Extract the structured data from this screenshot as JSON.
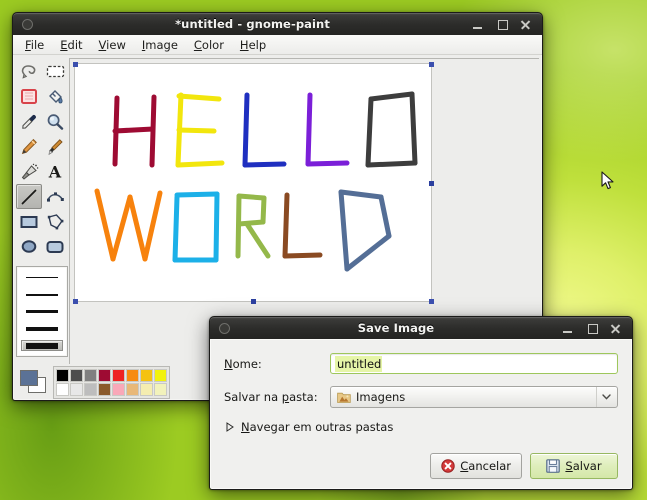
{
  "desktop": {
    "background_color": "#8fc524",
    "cursor": "arrow-pointer"
  },
  "paint_window": {
    "title": "*untitled - gnome-paint",
    "window_buttons": {
      "minimize": "minimize",
      "maximize": "maximize",
      "close": "close"
    },
    "menubar": [
      {
        "label": "File",
        "mnemonic": "F"
      },
      {
        "label": "Edit",
        "mnemonic": "E"
      },
      {
        "label": "View",
        "mnemonic": "V"
      },
      {
        "label": "Image",
        "mnemonic": "I"
      },
      {
        "label": "Color",
        "mnemonic": "C"
      },
      {
        "label": "Help",
        "mnemonic": "H"
      }
    ],
    "toolbox": [
      {
        "name": "free-form-select",
        "label": "Free-Form Select",
        "selected": false
      },
      {
        "name": "rectangle-select",
        "label": "Select",
        "selected": false
      },
      {
        "name": "eraser",
        "label": "Eraser",
        "selected": false
      },
      {
        "name": "fill-bucket",
        "label": "Fill With Color",
        "selected": false
      },
      {
        "name": "color-picker",
        "label": "Pick Color",
        "selected": false
      },
      {
        "name": "magnifier",
        "label": "Magnifier",
        "selected": false
      },
      {
        "name": "pencil",
        "label": "Pencil",
        "selected": false
      },
      {
        "name": "paintbrush",
        "label": "Brush",
        "selected": false
      },
      {
        "name": "airbrush",
        "label": "Airbrush",
        "selected": false
      },
      {
        "name": "text",
        "label": "Text",
        "selected": false
      },
      {
        "name": "line",
        "label": "Line",
        "selected": true
      },
      {
        "name": "curve",
        "label": "Curve",
        "selected": false
      },
      {
        "name": "rectangle",
        "label": "Rectangle",
        "selected": false
      },
      {
        "name": "polygon",
        "label": "Polygon",
        "selected": false
      },
      {
        "name": "ellipse",
        "label": "Ellipse",
        "selected": false
      },
      {
        "name": "rounded-rectangle",
        "label": "Rounded Rectangle",
        "selected": false
      }
    ],
    "line_widths": [
      {
        "thickness": 1,
        "selected": false
      },
      {
        "thickness": 2,
        "selected": false
      },
      {
        "thickness": 3,
        "selected": false
      },
      {
        "thickness": 4,
        "selected": false
      },
      {
        "thickness": 6,
        "selected": true
      }
    ],
    "palette": {
      "foreground": "#5b7296",
      "background": "#ffffff",
      "top_row": [
        "#000000",
        "#4d4d4d",
        "#808080",
        "#9e0b33",
        "#ee2222",
        "#f78b11",
        "#f5c211",
        "#f2f20d"
      ],
      "bottom_row": [
        "#ffffff",
        "#e8e8e8",
        "#bdbdbd",
        "#8a5a2b",
        "#f9a8b8",
        "#e8b878",
        "#f5edb0",
        "#f2f2bb"
      ]
    },
    "canvas": {
      "artwork_text": "HELLO WORLD",
      "words": [
        {
          "word": "HELLO",
          "letters": [
            {
              "char": "H",
              "color": "#9e0b33"
            },
            {
              "char": "E",
              "color": "#f2e60d"
            },
            {
              "char": "L",
              "color": "#1f2fc0"
            },
            {
              "char": "L",
              "color": "#7b1fd8"
            },
            {
              "char": "O",
              "color": "#3d3d3d"
            }
          ]
        },
        {
          "word": "WORLD",
          "letters": [
            {
              "char": "W",
              "color": "#f7820d"
            },
            {
              "char": "O",
              "color": "#1cb0e8"
            },
            {
              "char": "R",
              "color": "#94b84a"
            },
            {
              "char": "L",
              "color": "#8a4a22"
            },
            {
              "char": "D",
              "color": "#546e96"
            }
          ]
        }
      ],
      "selection_handle_color": "#2b3f9e"
    }
  },
  "save_dialog": {
    "title": "Save Image",
    "window_buttons": {
      "minimize": "minimize",
      "maximize": "maximize",
      "close": "close"
    },
    "name_label": "Nome:",
    "name_mnemonic": "N",
    "name_value": "untitled",
    "folder_label": "Salvar na pasta:",
    "folder_mnemonic": "p",
    "folder_value": "Imagens",
    "folder_icon": "folder-pictures-icon",
    "expander_label": "Navegar em outras pastas",
    "expander_mnemonic": "N",
    "cancel_label": "Cancelar",
    "cancel_mnemonic": "C",
    "cancel_icon": "cancel-circle-icon",
    "save_label": "Salvar",
    "save_mnemonic": "S",
    "save_icon": "floppy-save-icon"
  }
}
